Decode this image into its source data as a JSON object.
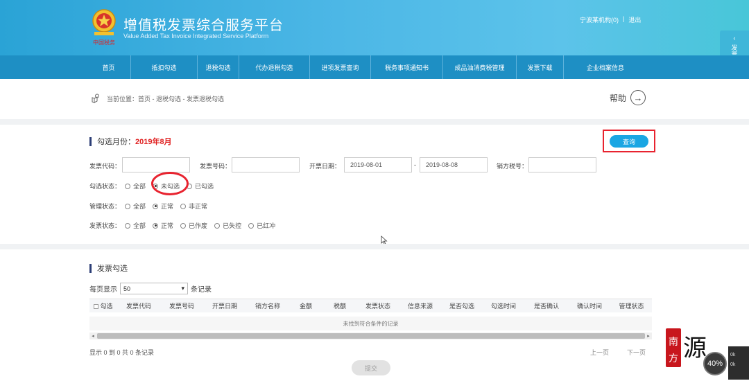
{
  "header": {
    "title_cn": "增值税发票综合服务平台",
    "title_en": "Value Added Tax Invoice Integrated Service Platform",
    "logo_text": "中国税务",
    "user_name": "宁波某机构(0)",
    "separator": "|",
    "logout": "退出"
  },
  "side_tab": {
    "label": "发票获取平台"
  },
  "nav": [
    {
      "label": "首页"
    },
    {
      "label": "抵扣勾选"
    },
    {
      "label": "退税勾选"
    },
    {
      "label": "代办退税勾选"
    },
    {
      "label": "进项发票查询"
    },
    {
      "label": "税务事项通知书"
    },
    {
      "label": "成品油消费税管理"
    },
    {
      "label": "发票下载"
    },
    {
      "label": "企业档案信息"
    }
  ],
  "breadcrumb": {
    "text": "当前位置：首页 - 退税勾选 - 发票退税勾选"
  },
  "help": {
    "label": "帮助"
  },
  "section1": {
    "title": "勾选月份：",
    "month": "2019年8月",
    "query_label": "查询"
  },
  "filters": {
    "invoice_code_label": "发票代码：",
    "invoice_code_value": "",
    "invoice_number_label": "发票号码：",
    "invoice_number_value": "",
    "date_label": "开票日期：",
    "date_from": "2019-08-01",
    "date_sep": "-",
    "date_to": "2019-08-08",
    "seller_tax_label": "销方税号：",
    "seller_tax_value": ""
  },
  "radio_groups": [
    {
      "label": "勾选状态：",
      "options": [
        "全部",
        "未勾选",
        "已勾选"
      ],
      "selected": 1
    },
    {
      "label": "管理状态：",
      "options": [
        "全部",
        "正常",
        "非正常"
      ],
      "selected": 1
    },
    {
      "label": "发票状态：",
      "options": [
        "全部",
        "正常",
        "已作废",
        "已失控",
        "已红冲"
      ],
      "selected": 1
    }
  ],
  "section2": {
    "title": "发票勾选"
  },
  "per_page": {
    "prefix": "每页显示",
    "value": "50",
    "suffix": "条记录"
  },
  "table": {
    "columns": [
      "勾选",
      "发票代码",
      "发票号码",
      "开票日期",
      "销方名称",
      "金额",
      "税额",
      "发票状态",
      "信息来源",
      "是否勾选",
      "勾选时间",
      "是否确认",
      "确认时间",
      "管理状态"
    ],
    "empty_text": "未找到符合条件的记录"
  },
  "summary": "显示 0 到 0 共 0 条记录",
  "pager": {
    "prev": "上一页",
    "next": "下一页"
  },
  "submit_label": "提交",
  "watermark_logo": {
    "chars": [
      "南",
      "方",
      "源"
    ]
  },
  "zoom": {
    "value": "40%",
    "side_lines": [
      "0k",
      "0k"
    ]
  }
}
